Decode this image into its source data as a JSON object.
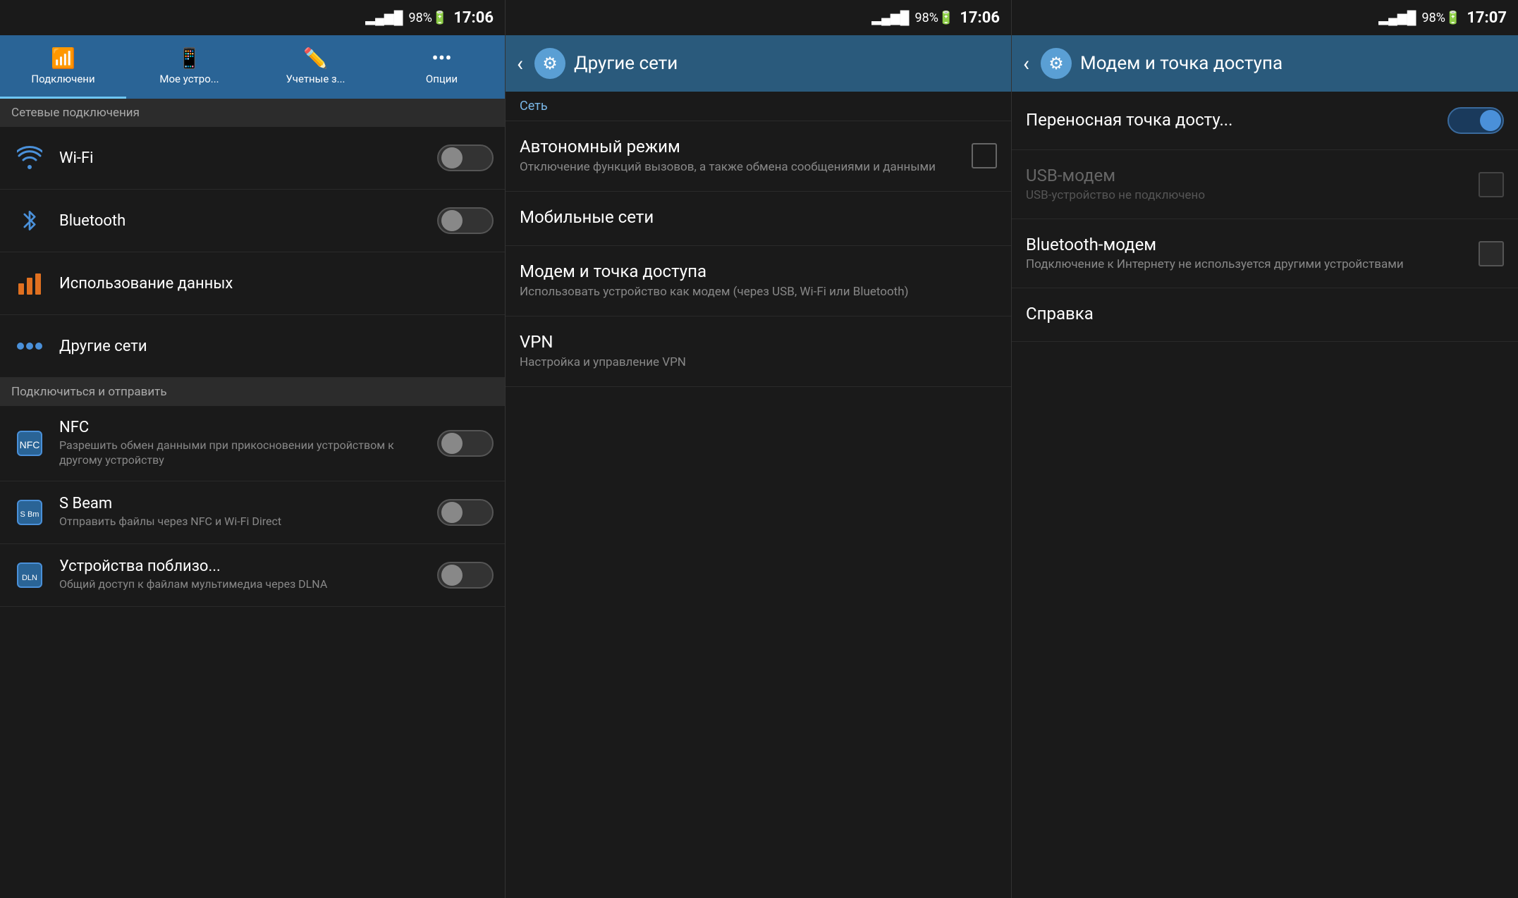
{
  "panels": {
    "left": {
      "status": {
        "signal": "▂▄▆█",
        "battery": "🔋98%",
        "time": "17:06"
      },
      "tabs": [
        {
          "id": "connections",
          "label": "Подключени",
          "icon": "📶",
          "active": true
        },
        {
          "id": "my-device",
          "label": "Мое устро...",
          "icon": "📱",
          "active": false
        },
        {
          "id": "accounts",
          "label": "Учетные з...",
          "icon": "✏️",
          "active": false
        },
        {
          "id": "options",
          "label": "Опции",
          "icon": "⋯",
          "active": false
        }
      ],
      "section_network": "Сетевые подключения",
      "items_network": [
        {
          "id": "wifi",
          "title": "Wi-Fi",
          "subtitle": "",
          "icon": "wifi",
          "toggle": true,
          "toggle_state": "off"
        },
        {
          "id": "bluetooth",
          "title": "Bluetooth",
          "subtitle": "",
          "icon": "bluetooth",
          "toggle": true,
          "toggle_state": "off"
        },
        {
          "id": "data-usage",
          "title": "Использование данных",
          "subtitle": "",
          "icon": "data",
          "toggle": false,
          "toggle_state": ""
        },
        {
          "id": "other-networks",
          "title": "Другие сети",
          "subtitle": "",
          "icon": "dots",
          "toggle": false,
          "toggle_state": ""
        }
      ],
      "section_connect": "Подключиться и отправить",
      "items_connect": [
        {
          "id": "nfc",
          "title": "NFC",
          "subtitle": "Разрешить обмен данными при прикосновении устройством к другому устройству",
          "icon": "nfc",
          "toggle": true,
          "toggle_state": "off"
        },
        {
          "id": "sbeam",
          "title": "S Beam",
          "subtitle": "Отправить файлы через NFC и Wi-Fi Direct",
          "icon": "sbeam",
          "toggle": true,
          "toggle_state": "off"
        },
        {
          "id": "nearby",
          "title": "Устройства поблизо...",
          "subtitle": "Общий доступ к файлам мультимедиа через DLNA",
          "icon": "nearby",
          "toggle": true,
          "toggle_state": "off"
        }
      ]
    },
    "middle": {
      "status": {
        "signal": "▂▄▆█",
        "battery": "🔋98%",
        "time": "17:06"
      },
      "back_label": "‹",
      "title": "Другие сети",
      "section_net": "Сеть",
      "items": [
        {
          "id": "autonomous",
          "title": "Автономный режим",
          "subtitle": "Отключение функций вызовов, а также обмена сообщениями и данными",
          "has_check": true
        },
        {
          "id": "mobile-net",
          "title": "Мобильные сети",
          "subtitle": "",
          "has_check": false
        },
        {
          "id": "modem-hotspot",
          "title": "Модем и точка доступа",
          "subtitle": "Использовать устройство как модем (через USB, Wi-Fi или Bluetooth)",
          "has_check": false
        },
        {
          "id": "vpn",
          "title": "VPN",
          "subtitle": "Настройка и управление VPN",
          "has_check": false
        }
      ]
    },
    "right": {
      "status": {
        "signal": "▂▄▆█",
        "battery": "🔋98%",
        "time": "17:07"
      },
      "back_label": "‹",
      "title": "Модем и точка доступа",
      "items": [
        {
          "id": "portable-hotspot",
          "title": "Переносная точка досту...",
          "subtitle": "",
          "toggle": true,
          "toggle_state": "on",
          "disabled": false
        },
        {
          "id": "usb-modem",
          "title": "USB-модем",
          "subtitle": "USB-устройство не подключено",
          "toggle": false,
          "has_check": true,
          "disabled": true
        },
        {
          "id": "bluetooth-modem",
          "title": "Bluetooth-модем",
          "subtitle": "Подключение к Интернету не используется другими устройствами",
          "toggle": false,
          "has_check": true,
          "disabled": false
        },
        {
          "id": "help",
          "title": "Справка",
          "subtitle": "",
          "toggle": false,
          "has_check": false,
          "disabled": false
        }
      ]
    }
  }
}
